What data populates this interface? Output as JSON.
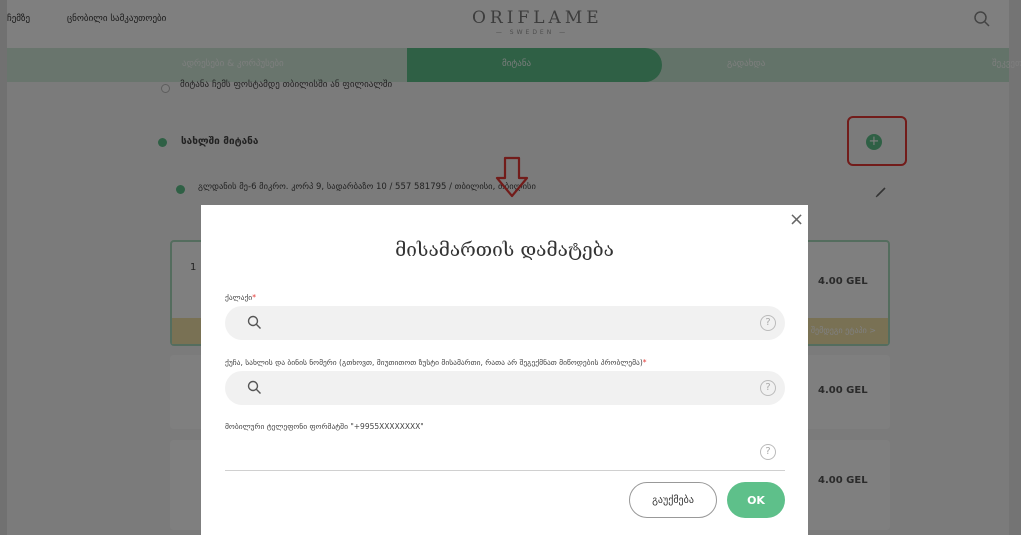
{
  "header": {
    "nav": [
      "ჩემზე",
      "ცნობილი სამკაუთოები"
    ],
    "logo_main": "ORIFLAME",
    "logo_sub": "— SWEDEN —"
  },
  "steps": {
    "items": [
      "ადრესები & კორპუსები",
      "მიტანა",
      "გადახდა",
      "შეკვეთა"
    ]
  },
  "background": {
    "option_partial": "მიტანა ჩემს ფოსტამდე თბილისში ან ფილიალში",
    "home_delivery_label": "სახლში მიტანა",
    "address_line": "გლდანის მე-6 მიკრო. კორპ 9, სადარბაზო 10 / 557 581795 / თბილისი, თბილისი",
    "card_prefix": "1",
    "prices": [
      "4.00 GEL",
      "4.00 GEL",
      "4.00 GEL"
    ],
    "yellow_note": "შემდეგი ეტაპი >"
  },
  "modal": {
    "title": "მისამართის დამატება",
    "city_label": "ქალაქი",
    "street_label": "ქუჩა, სახლის და ბინის ნომერი (გთხოვთ, მიუთითოთ ზუსტი მისამართი, რათა არ შეგექმნათ მიწოდების პრობლემა)",
    "phone_label": "მობილური ტელეფონი ფორმატში \"+9955XXXXXXXX\"",
    "help_glyph": "?",
    "cancel_label": "გაუქმება",
    "ok_label": "OK"
  },
  "colors": {
    "accent_green": "#5ec08a",
    "annotation_red": "#e53935"
  }
}
